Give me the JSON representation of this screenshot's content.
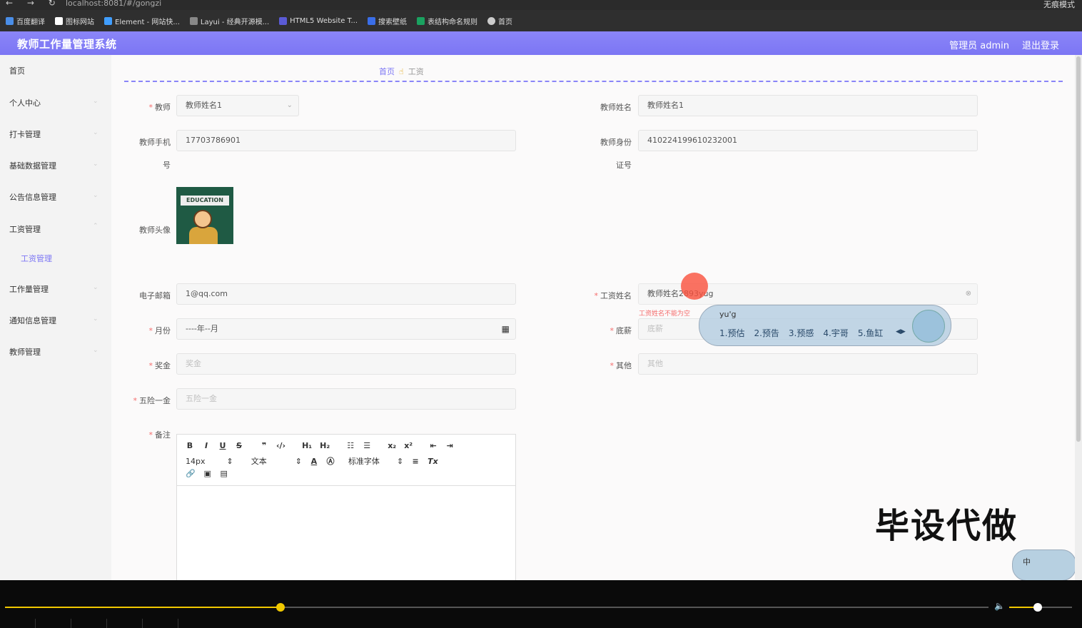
{
  "browser": {
    "url": "localhost:8081/#/gongzi",
    "mode": "无痕模式",
    "bookmarks": [
      "百度翻译",
      "图标网站",
      "Element - 网站快...",
      "Layui - 经典开源模...",
      "HTML5 Website T...",
      "搜索壁纸",
      "表结构命名规则",
      "首页"
    ]
  },
  "header": {
    "title": "教师工作量管理系统",
    "admin": "管理员 admin",
    "logout": "退出登录"
  },
  "sidebar": {
    "items": [
      "首页",
      "个人中心",
      "打卡管理",
      "基础数据管理",
      "公告信息管理",
      "工资管理",
      "工作量管理",
      "通知信息管理",
      "教师管理"
    ],
    "sub_item": "工资管理"
  },
  "breadcrumb": {
    "home": "首页",
    "current": "工资"
  },
  "form": {
    "teacher_label": "教师",
    "teacher_value": "教师姓名1",
    "teacher_name_label": "教师姓名",
    "teacher_name_value": "教师姓名1",
    "phone_label_1": "教师手机",
    "phone_label_2": "号",
    "phone_value": "17703786901",
    "id_label_1": "教师身份",
    "id_label_2": "证号",
    "id_value": "410224199610232001",
    "avatar_label": "教师头像",
    "avatar_text": "EDUCATION",
    "email_label": "电子邮箱",
    "email_value": "1@qq.com",
    "salary_name_label": "工资姓名",
    "salary_name_value": "教师姓名2893yug",
    "salary_name_error": "工资姓名不能为空",
    "month_label": "月份",
    "month_value": "----年--月",
    "base_label": "底薪",
    "base_placeholder": "底薪",
    "bonus_label": "奖金",
    "bonus_placeholder": "奖金",
    "other_label": "其他",
    "other_placeholder": "其他",
    "insurance_label": "五险一金",
    "insurance_placeholder": "五险一金",
    "remark_label": "备注"
  },
  "editor": {
    "font_size": "14px",
    "text_type": "文本",
    "font_family": "标准字体"
  },
  "ime": {
    "pinyin": "yu'g",
    "candidates": [
      "1.预估",
      "2.预告",
      "3.预感",
      "4.宇哥",
      "5.鱼缸"
    ],
    "mini_label": "中"
  },
  "watermark": "毕设代做",
  "player": {
    "progress": 0.28,
    "volume": 0.45
  }
}
